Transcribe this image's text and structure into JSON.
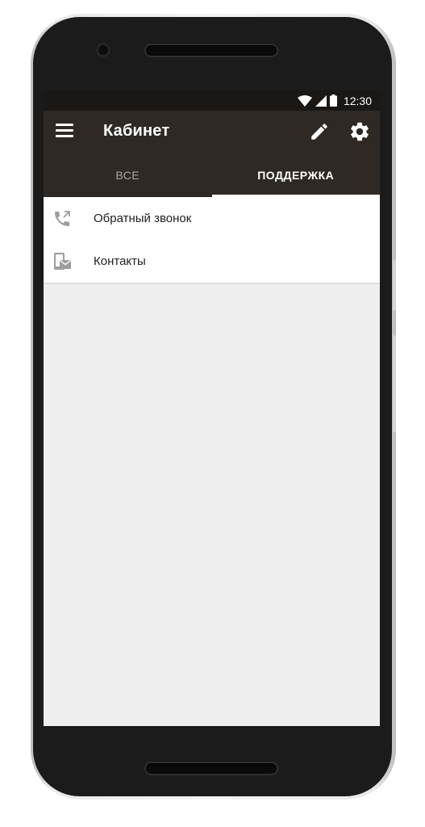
{
  "status_bar": {
    "time": "12:30",
    "icons": [
      "wifi-icon",
      "cell-signal-icon",
      "battery-icon"
    ]
  },
  "toolbar": {
    "title": "Кабинет",
    "icons": [
      "menu-icon",
      "edit-icon",
      "settings-icon"
    ]
  },
  "tabs": [
    {
      "label": "ВСЕ",
      "active": false
    },
    {
      "label": "ПОДДЕРЖКА",
      "active": true
    }
  ],
  "support_items": [
    {
      "label": "Обратный звонок",
      "icon": "callback-phone-icon"
    },
    {
      "label": "Контакты",
      "icon": "contacts-mail-icon"
    }
  ],
  "colors": {
    "status_bar": "#1a1714",
    "app_bar": "#2e2925",
    "tab_indicator": "#ffffff",
    "screen_background": "#eeeeee",
    "icon_gray": "#9e9e9e"
  }
}
